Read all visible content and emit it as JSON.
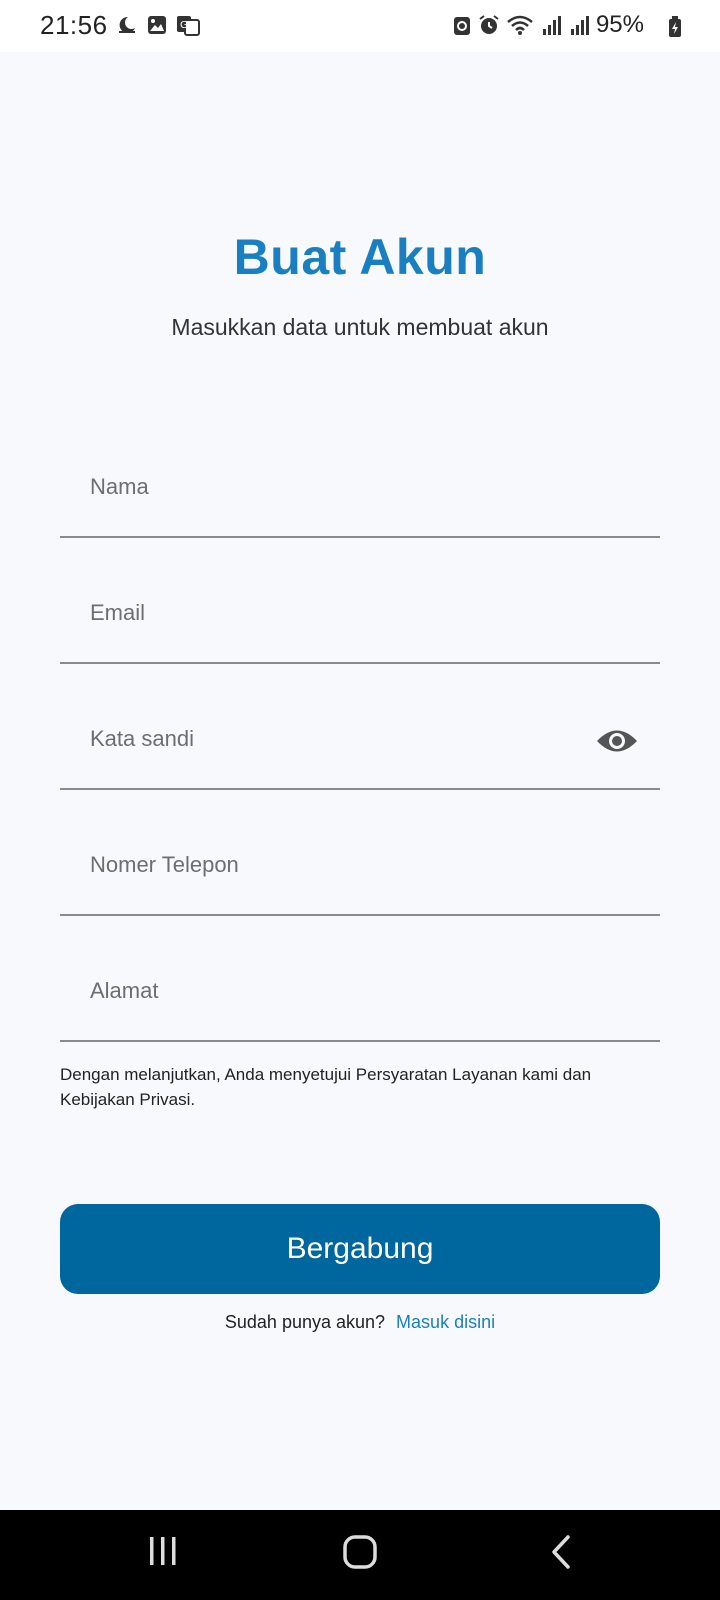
{
  "status_bar": {
    "time": "21:56",
    "battery": "95%",
    "left_icons": [
      "moon-icon",
      "gallery-icon",
      "translate-icon"
    ],
    "right_icons": [
      "recycle-icon",
      "alarm-icon",
      "wifi-icon",
      "signal-icon",
      "signal-icon"
    ]
  },
  "header": {
    "title": "Buat Akun",
    "subtitle": "Masukkan data untuk membuat akun"
  },
  "form": {
    "fields": [
      {
        "placeholder": "Nama"
      },
      {
        "placeholder": "Email"
      },
      {
        "placeholder": "Kata sandi"
      },
      {
        "placeholder": "Nomer Telepon"
      },
      {
        "placeholder": "Alamat"
      }
    ],
    "terms": "Dengan melanjutkan, Anda menyetujui Persyaratan Layanan kami dan Kebijakan Privasi.",
    "join_label": "Bergabung"
  },
  "login": {
    "prompt": "Sudah punya akun?",
    "link": "Masuk disini"
  },
  "colors": {
    "accent": "#1a7fc1",
    "button": "#00669e",
    "background": "#f8f9fc"
  }
}
